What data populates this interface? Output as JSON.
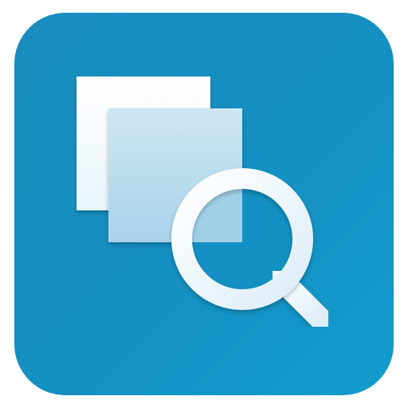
{
  "app_icon": {
    "name": "compare-search-app-icon",
    "colors": {
      "background_gradient_start": "#1a93c6",
      "background_gradient_end": "#1197c9",
      "background_mid": "#138fc1",
      "back_page": "#f4fbff",
      "front_page": "#c9e4f3",
      "magnifier_ring": "#eaf5fb",
      "magnifier_lens": "#9fd0e8"
    }
  }
}
